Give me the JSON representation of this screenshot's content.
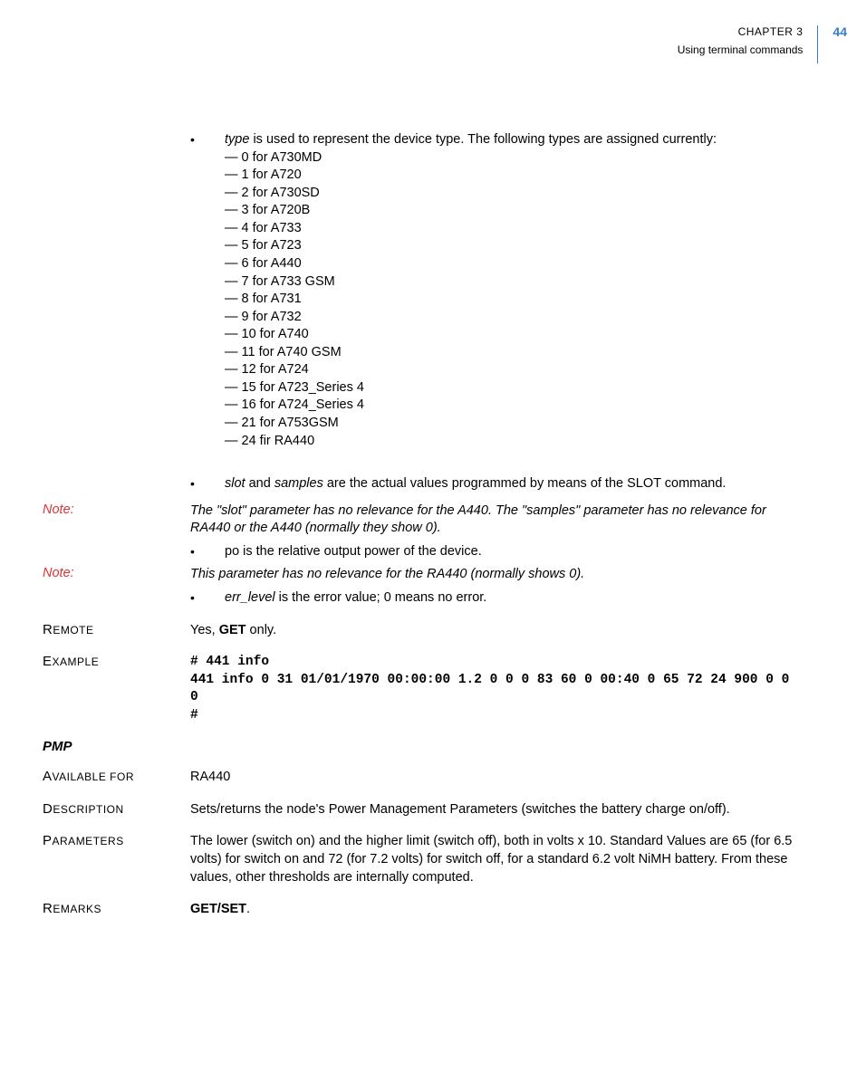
{
  "header": {
    "chapter": "CHAPTER 3",
    "subtitle": "Using terminal commands",
    "page_number": "44"
  },
  "bullet1": {
    "intro_prefix": "type",
    "intro_rest": " is used to represent the device type. The following types are assigned currently:",
    "items": [
      "— 0 for A730MD",
      "— 1 for A720",
      "— 2 for A730SD",
      "— 3 for A720B",
      "— 4 for A733",
      "— 5 for A723",
      "— 6 for A440",
      "— 7 for A733 GSM",
      "— 8 for A731",
      "— 9 for A732",
      "— 10 for A740",
      "— 11 for A740 GSM",
      "— 12 for A724",
      "— 15 for A723_Series 4",
      "— 16 for A724_Series 4",
      "— 21 for A753GSM",
      "— 24 fir RA440"
    ]
  },
  "bullet2": {
    "prefix1": "slot",
    "mid": " and ",
    "prefix2": "samples",
    "rest": " are the actual values programmed by means of the SLOT command."
  },
  "note1": {
    "label": "Note:",
    "body": "The \"slot\" parameter has no relevance for the A440. The \"samples\" parameter has no relevance for RA440 or the A440 (normally they show 0)."
  },
  "bullet3": {
    "text": "po is the relative output power of the device."
  },
  "note2": {
    "label": "Note:",
    "body": "This parameter has no relevance for the RA440 (normally shows 0)."
  },
  "bullet4": {
    "prefix": "err_level",
    "rest": " is the error value; 0 means no error."
  },
  "remote": {
    "label": "REMOTE",
    "pre": "Yes, ",
    "bold": "GET",
    "post": " only."
  },
  "example": {
    "label": "EXAMPLE",
    "code": "# 441 info\n441 info 0 31 01/01/1970 00:00:00 1.2 0 0 0 83 60 0 00:40 0 65 72 24 900 0 0 0\n#"
  },
  "section2": {
    "heading": "PMP",
    "available_for": {
      "label": "AVAILABLE FOR",
      "value": "RA440"
    },
    "description": {
      "label": "DESCRIPTION",
      "value": "Sets/returns the node's Power Management Parameters (switches the battery charge on/off)."
    },
    "parameters": {
      "label": "PARAMETERS",
      "value": "The lower (switch on) and the higher limit (switch off), both in volts x 10. Standard Values are 65 (for 6.5 volts) for switch on and 72 (for 7.2 volts) for switch off, for a standard 6.2 volt NiMH battery. From these values, other thresholds are internally computed."
    },
    "remarks": {
      "label": "REMARKS",
      "bold": "GET/SET",
      "post": "."
    }
  }
}
